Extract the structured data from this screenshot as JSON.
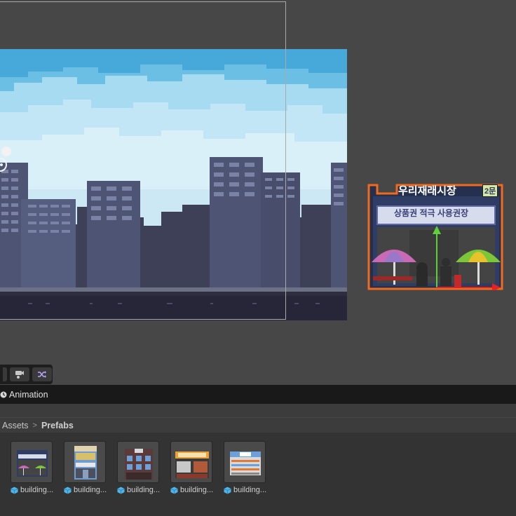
{
  "scene_view": {
    "sprite_sign_main": "우리재래시장",
    "sprite_sign_badge": "2문",
    "sprite_banner": "상품권 적극 사용권장"
  },
  "toolbar": {
    "buttons": [
      "camera-icon",
      "shuffle-icon"
    ]
  },
  "animation_tab": {
    "label": "Animation"
  },
  "breadcrumb": {
    "root": "Assets",
    "current": "Prefabs"
  },
  "assets": [
    {
      "label": "building...",
      "icon": "prefab-cube-icon"
    },
    {
      "label": "building...",
      "icon": "prefab-cube-icon"
    },
    {
      "label": "building...",
      "icon": "prefab-cube-icon"
    },
    {
      "label": "building...",
      "icon": "prefab-cube-icon"
    },
    {
      "label": "building...",
      "icon": "prefab-cube-icon"
    }
  ],
  "colors": {
    "editor_bg": "#474747",
    "sky": "#4aa9d9",
    "selection_outline": "#f26a1b",
    "gizmo_y": "#5bd13b",
    "gizmo_x": "#e02323",
    "prefab_icon": "#4fb4e8"
  }
}
